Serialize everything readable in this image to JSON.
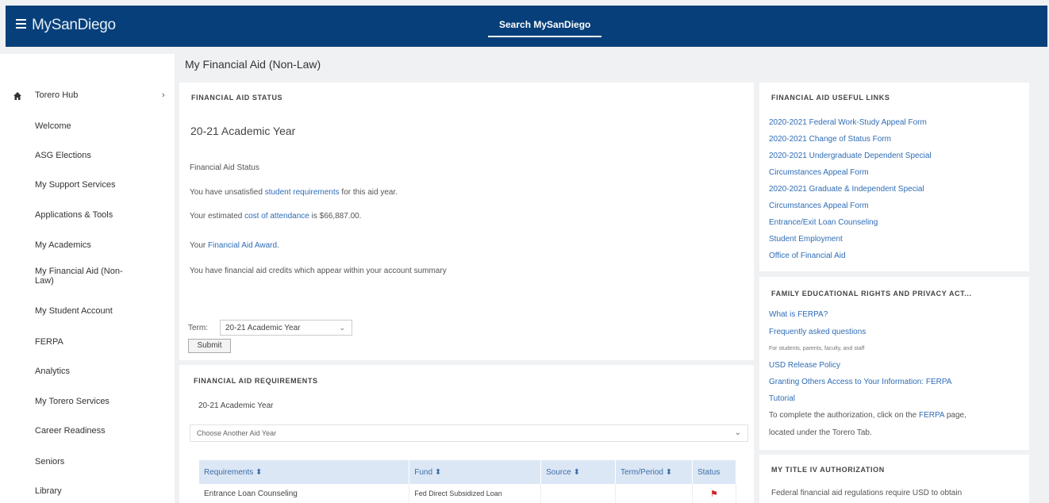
{
  "header": {
    "brand": "MySanDiego",
    "search_label": "Search MySanDiego"
  },
  "sidebar": {
    "hub_label": "Torero Hub",
    "items": [
      {
        "label": "Welcome"
      },
      {
        "label": "ASG Elections"
      },
      {
        "label": "My Support Services"
      },
      {
        "label": "Applications & Tools"
      },
      {
        "label": "My Academics"
      },
      {
        "label": "My Financial Aid (Non-"
      },
      {
        "label": "Law)"
      },
      {
        "label": "My Student Account"
      },
      {
        "label": "FERPA"
      },
      {
        "label": "Analytics"
      },
      {
        "label": "My Torero Services"
      },
      {
        "label": "Career Readiness"
      },
      {
        "label": "Seniors"
      },
      {
        "label": "Library"
      }
    ]
  },
  "page_title": "My Financial Aid (Non-Law)",
  "status_card": {
    "heading": "FINANCIAL AID STATUS",
    "year": "20-21 Academic Year",
    "status_link": "Financial Aid Status",
    "req_prefix": "You have unsatisfied ",
    "req_link": "student requirements",
    "req_suffix": " for this aid year.",
    "coa_prefix": "Your estimated ",
    "coa_link": "cost of attendance",
    "coa_suffix": " is $66,887.00.",
    "award_prefix": "Your ",
    "award_link": "Financial Aid Award",
    "award_suffix": ".",
    "credits_text": "You have financial aid credits which appear within your account summary",
    "term_label": "Term:",
    "term_value": "20-21 Academic Year",
    "submit_label": "Submit"
  },
  "requirements_card": {
    "heading": "FINANCIAL AID REQUIREMENTS",
    "year": "20-21 Academic Year",
    "choose_placeholder": "Choose Another Aid Year",
    "columns": [
      "Requirements ⬍",
      "Fund ⬍",
      "Source ⬍",
      "Term/Period ⬍",
      "Status"
    ],
    "rows": [
      {
        "requirement": "Entrance Loan Counseling",
        "fund": "Fed Direct Subsidized Loan",
        "source": "",
        "term": "",
        "status": "flag"
      }
    ]
  },
  "useful_links": {
    "heading": "FINANCIAL AID USEFUL LINKS",
    "links": [
      "2020-2021 Federal Work-Study Appeal Form",
      "2020-2021 Change of Status Form",
      "2020-2021 Undergraduate Dependent Special",
      "Circumstances Appeal Form",
      "2020-2021 Graduate & Independent Special",
      "Circumstances Appeal Form",
      "Entrance/Exit Loan Counseling",
      "Student Employment",
      "Office of Financial Aid"
    ]
  },
  "ferpa_card": {
    "heading": "FAMILY EDUCATIONAL RIGHTS AND PRIVACY ACT...",
    "what_link": "What is FERPA?",
    "faq_link": "Frequently asked questions",
    "faq_note": "For students, parents, faculty, and staff",
    "release_link": "USD Release Policy",
    "granting_link": "Granting Others Access to Your Information: FERPA",
    "tutorial_link": "Tutorial",
    "complete_prefix": "To complete the authorization, click on the ",
    "complete_link": "FERPA",
    "complete_suffix": " page,",
    "located_text": "located under the Torero Tab."
  },
  "title_iv_card": {
    "heading": "MY TITLE IV AUTHORIZATION",
    "text": "Federal financial aid regulations require USD to obtain"
  }
}
